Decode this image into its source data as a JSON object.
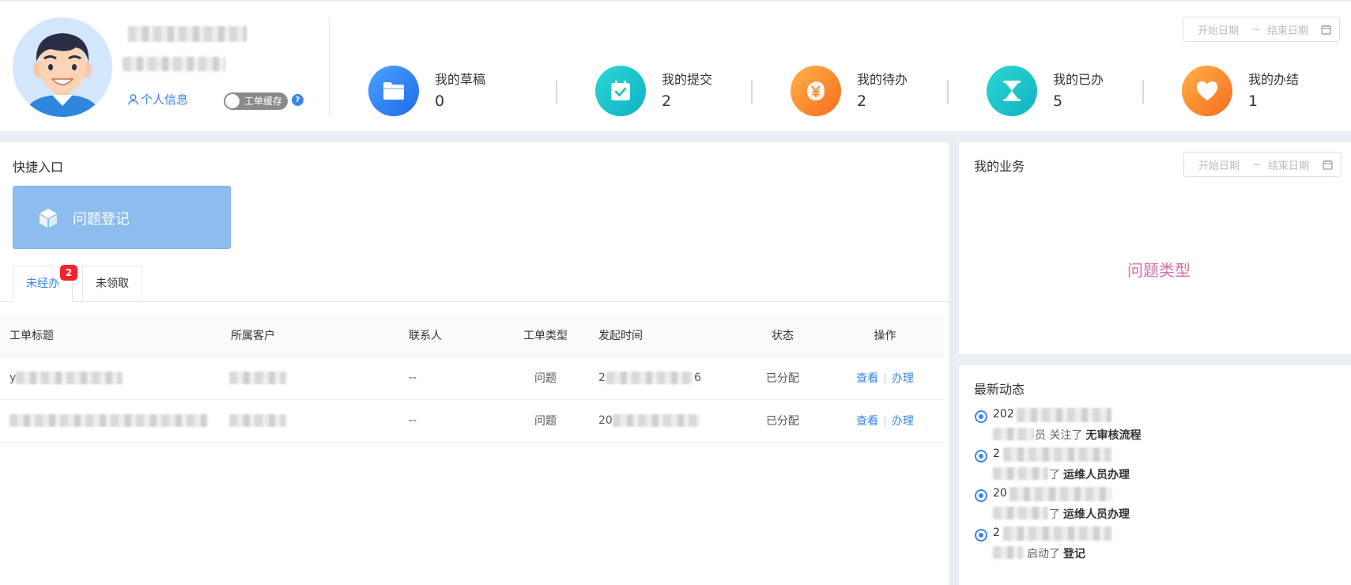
{
  "profile": {
    "link_label": "个人信息",
    "toggle_label": "工单缓存",
    "help_mark": "?"
  },
  "date_filter": {
    "start_placeholder": "开始日期",
    "separator": "~",
    "end_placeholder": "结束日期"
  },
  "stats": [
    {
      "label": "我的草稿",
      "value": "0",
      "icon": "folder-icon",
      "color": "#2f86f6"
    },
    {
      "label": "我的提交",
      "value": "2",
      "icon": "calendar-check-icon",
      "color": "#12c0c8"
    },
    {
      "label": "我的待办",
      "value": "2",
      "icon": "yen-icon",
      "color": "#f9872a"
    },
    {
      "label": "我的已办",
      "value": "5",
      "icon": "hourglass-icon",
      "color": "#12c0c8"
    },
    {
      "label": "我的办结",
      "value": "1",
      "icon": "heart-icon",
      "color": "#f9872a"
    }
  ],
  "quick_entry": {
    "title": "快捷入口",
    "button_label": "问题登记",
    "icon": "cube-icon"
  },
  "tabs": [
    {
      "label": "未经办",
      "badge": "2"
    },
    {
      "label": "未领取"
    }
  ],
  "table": {
    "headers": [
      "工单标题",
      "所属客户",
      "联系人",
      "工单类型",
      "发起时间",
      "状态",
      "操作"
    ],
    "rows": [
      {
        "title_prefix": "y",
        "contact": "--",
        "type": "问题",
        "time_prefix": "2",
        "time_suffix": "6",
        "status": "已分配"
      },
      {
        "title_prefix": "",
        "contact": "--",
        "type": "问题",
        "time_prefix": "20",
        "time_suffix": "",
        "status": "已分配"
      }
    ],
    "action_view": "查看",
    "action_handle": "办理"
  },
  "business": {
    "title": "我的业务",
    "chart_title": "问题类型"
  },
  "dynamics": {
    "title": "最新动态",
    "items": [
      {
        "time_prefix": "202",
        "verb": "员 关注了",
        "target": "无审核流程"
      },
      {
        "time_prefix": "2",
        "verb": "了",
        "target": "运维人员办理"
      },
      {
        "time_prefix": "20",
        "verb": "了",
        "target": "运维人员办理"
      },
      {
        "time_prefix": "2",
        "verb": "启动了",
        "target": "登记"
      }
    ]
  }
}
